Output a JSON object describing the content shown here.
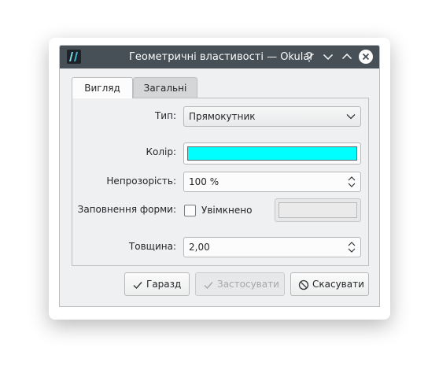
{
  "window": {
    "title": "Геометричні властивості — Okular"
  },
  "tabs": [
    {
      "label": "Вигляд",
      "active": true
    },
    {
      "label": "Загальні",
      "active": false
    }
  ],
  "form": {
    "type_label": "Тип:",
    "type_value": "Прямокутник",
    "color_label": "Колір:",
    "color_value": "#00ffff",
    "opacity_label": "Непрозорість:",
    "opacity_value": "100 %",
    "fill_label": "Заповнення форми:",
    "fill_checkbox_label": "Увімкнено",
    "fill_checked": false,
    "width_label": "Товщина:",
    "width_value": "2,00"
  },
  "buttons": {
    "ok": "Гаразд",
    "apply": "Застосувати",
    "cancel": "Скасувати"
  },
  "colors": {
    "titlebar": "#475057",
    "window_bg": "#eff0f1",
    "swatch": "#00ffff"
  }
}
